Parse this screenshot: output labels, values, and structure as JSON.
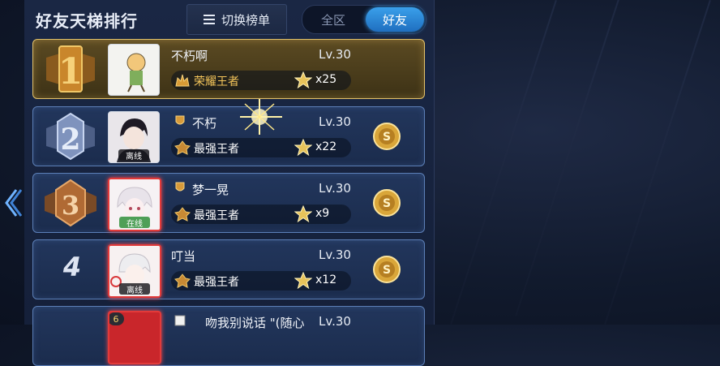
{
  "header": {
    "title": "好友天梯排行",
    "switch_label": "切换榜单",
    "tab_all": "全区",
    "tab_friends": "好友"
  },
  "rows": [
    {
      "rank": "1",
      "name": "不朽啊",
      "level": "Lv.30",
      "tier": "荣耀王者",
      "stars": "x25",
      "status": ""
    },
    {
      "rank": "2",
      "name": "不朽",
      "level": "Lv.30",
      "tier": "最强王者",
      "stars": "x22",
      "status": "离线"
    },
    {
      "rank": "3",
      "name": "梦一晃",
      "level": "Lv.30",
      "tier": "最强王者",
      "stars": "x9",
      "status": "在线"
    },
    {
      "rank": "4",
      "name": "叮当",
      "level": "Lv.30",
      "tier": "最强王者",
      "stars": "x12",
      "status": "离线"
    },
    {
      "rank": "6",
      "name": "吻我别说话 \"(随心",
      "level": "Lv.30"
    }
  ],
  "colors": {
    "gold_border": "#e3c26a",
    "blue_border": "#5c7fb7",
    "active_tab": "#2f8ad8",
    "tier_gold": "#f3c45a"
  },
  "icons": [
    "menu-icon",
    "star-icon",
    "coin-icon",
    "tier-crown-icon",
    "left-arrow-icon",
    "medal-icon"
  ]
}
